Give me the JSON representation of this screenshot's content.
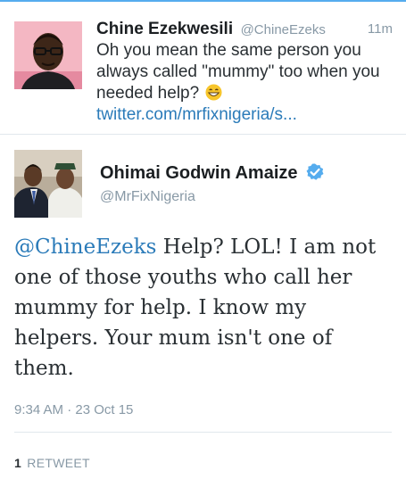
{
  "reply_tweet": {
    "author_name": "Chine Ezekwesili",
    "author_handle": "@ChineEzeks",
    "time": "11m",
    "text_before_emoji": "Oh you mean the same person you always called \"mummy\" too when you needed help?",
    "emoji_icon": "grinning-face-emoji",
    "link_text": "twitter.com/mrfixnigeria/s..."
  },
  "main_tweet": {
    "author_name": "Ohimai Godwin Amaize",
    "verified_icon": "verified-badge-icon",
    "author_handle": "@MrFixNigeria",
    "mention": "@ChineEzeks",
    "text": " Help? LOL! I am not one of those youths who call her mummy for help. I know my helpers. Your mum isn't one of them.",
    "timestamp": "9:34 AM · 23 Oct 15",
    "retweet_count": "1",
    "retweet_label": "RETWEET"
  },
  "colors": {
    "link": "#2b7bb9",
    "verified": "#55acee",
    "muted_text": "#8899a6",
    "divider": "#e1e8ed",
    "top_bar": "#55acee"
  }
}
